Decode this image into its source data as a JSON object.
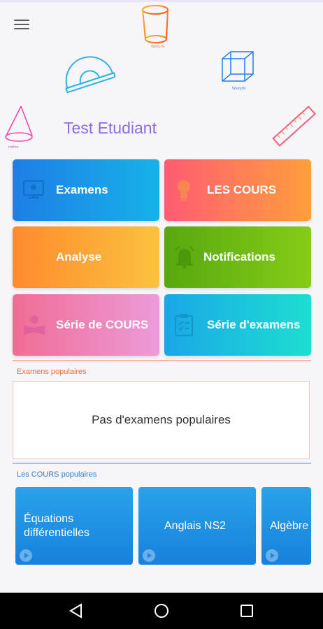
{
  "header": {
    "title": "Test Etudiant"
  },
  "tiles": [
    {
      "label": "Examens"
    },
    {
      "label": "LES COURS"
    },
    {
      "label": "Analyse"
    },
    {
      "label": "Notifications"
    },
    {
      "label": "Série de COURS"
    },
    {
      "label": "Série d'examens"
    }
  ],
  "popular_exams": {
    "heading": "Examens populaires",
    "empty_text": "Pas d'examens populaires"
  },
  "popular_courses": {
    "heading": "Les COURS populaires",
    "items": [
      {
        "title": "Équations différentielles"
      },
      {
        "title": "Anglais NS2"
      },
      {
        "title": "Algèbre"
      }
    ]
  },
  "colors": {
    "title": "#8f6be0",
    "exam_heading": "#ef6c45",
    "course_heading": "#2a7fd6"
  }
}
